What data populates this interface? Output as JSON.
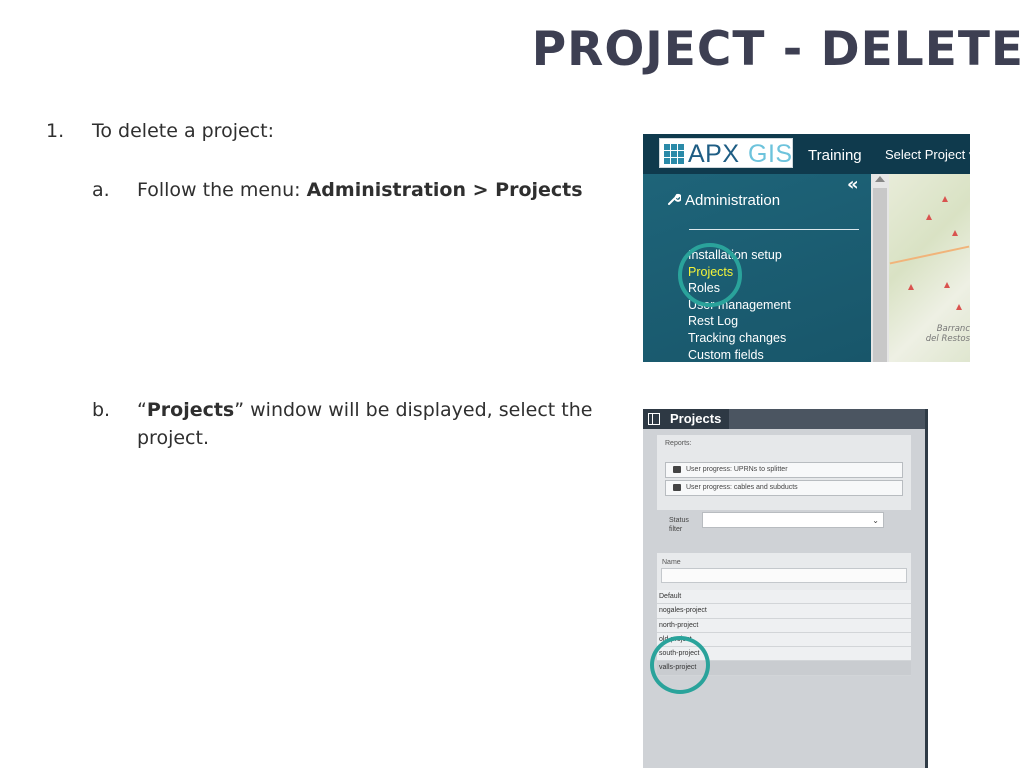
{
  "slide": {
    "title": "PROJECT - DELETE"
  },
  "steps": {
    "step1": {
      "number": "1.",
      "text": "To delete a project:"
    },
    "step_a": {
      "letter": "a.",
      "prefix": "Follow the menu: ",
      "bold": "Administration > Projects"
    },
    "step_b": {
      "letter": "b.",
      "open_quote": "“",
      "bold": "Projects",
      "line1_rest": "” window will be displayed, select the",
      "line2": "project."
    }
  },
  "screenshot_menu": {
    "logo": {
      "part1": "APX",
      "part2": "GIS"
    },
    "nav": [
      "Training",
      "Select Project ▾"
    ],
    "collapse_icon": "«",
    "section_title": "Administration",
    "items": [
      {
        "label": "Installation setup",
        "active": false
      },
      {
        "label": "Projects",
        "active": true
      },
      {
        "label": "Roles",
        "active": false
      },
      {
        "label": "User management",
        "active": false
      },
      {
        "label": "Rest Log",
        "active": false
      },
      {
        "label": "Tracking changes",
        "active": false
      },
      {
        "label": "Custom fields",
        "active": false
      }
    ],
    "map_label": "Barranc del Restos",
    "highlight_color": "#2aa39b",
    "active_color": "#f3f43a"
  },
  "screenshot_projects": {
    "window_title": "Projects",
    "reports_label": "Reports:",
    "reports": [
      "User progress: UPRNs to splitter",
      "User progress: cables and subducts"
    ],
    "status_filter_label": "Status filter",
    "name_column": "Name",
    "projects": [
      "Default",
      "nogales-project",
      "north-project",
      "old-project",
      "south-project",
      "valls-project"
    ],
    "selected_project": "valls-project"
  }
}
